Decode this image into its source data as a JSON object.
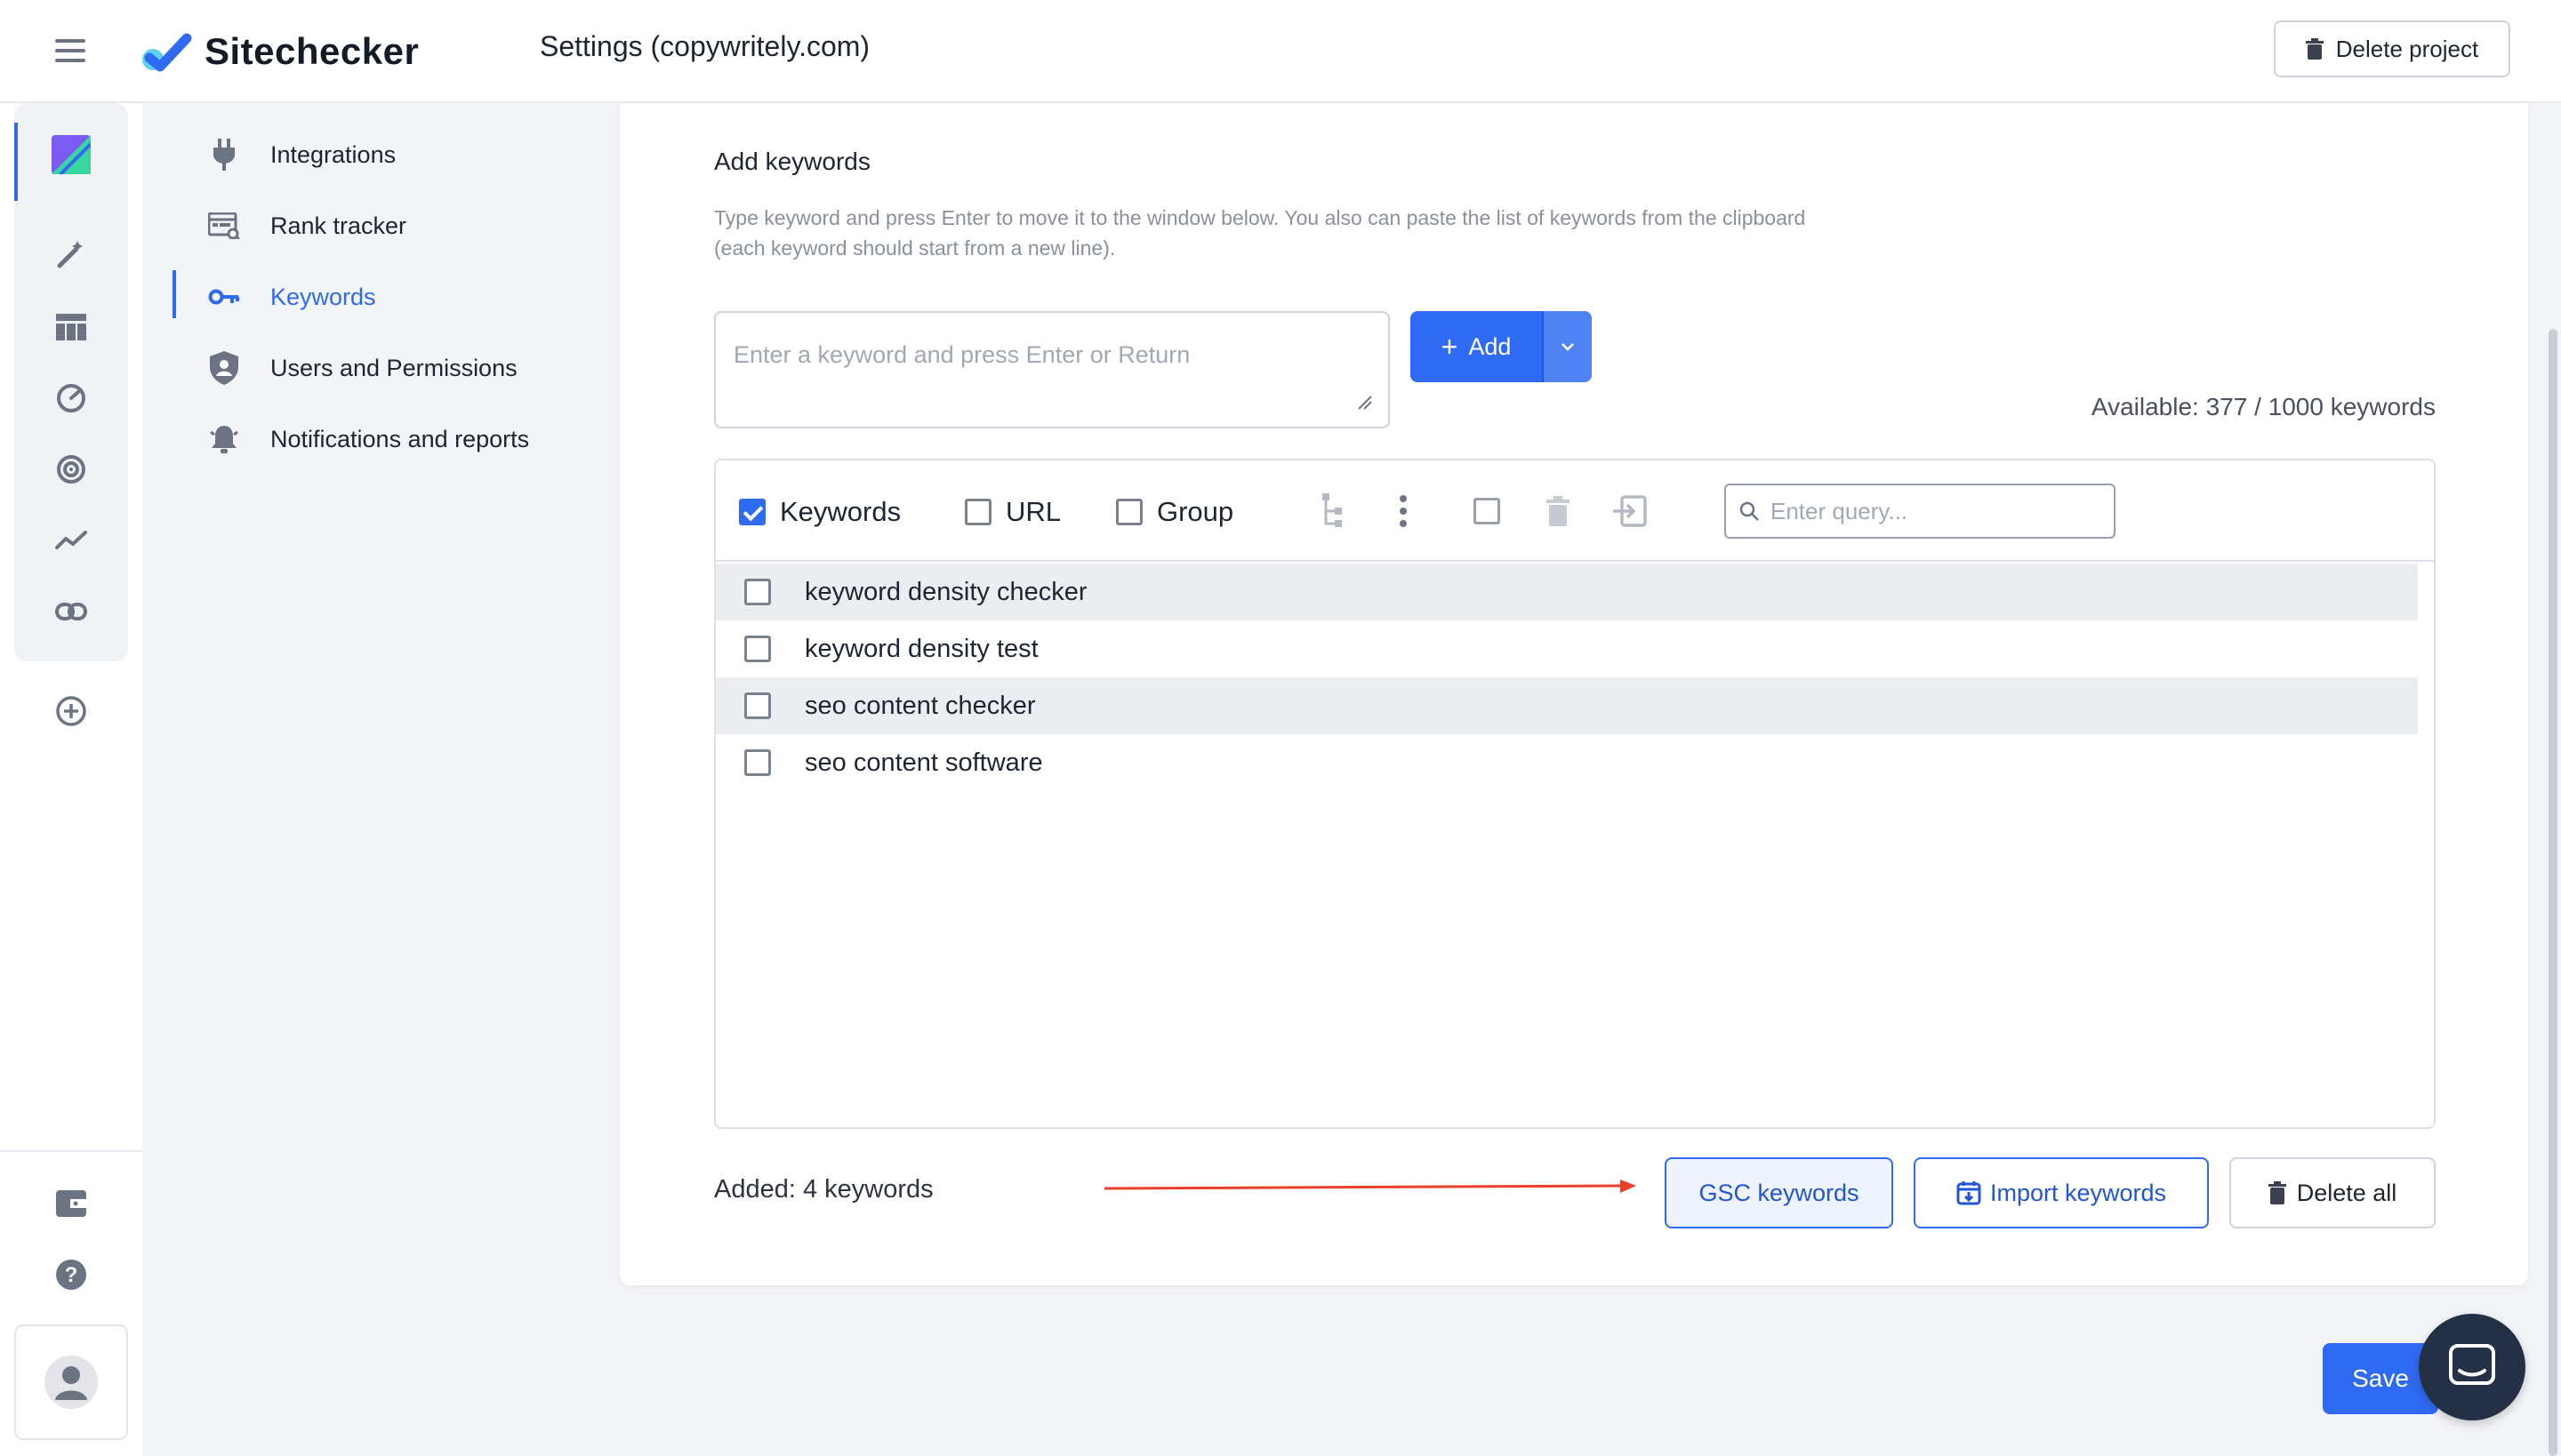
{
  "app": {
    "name": "Sitechecker"
  },
  "header": {
    "title": "Settings (copywritely.com)",
    "delete_project_label": "Delete project"
  },
  "settings_nav": {
    "items": [
      {
        "label": "Integrations",
        "icon": "plug-icon"
      },
      {
        "label": "Rank tracker",
        "icon": "rank-tracker-icon"
      },
      {
        "label": "Keywords",
        "icon": "key-icon",
        "active": true
      },
      {
        "label": "Users and Permissions",
        "icon": "shield-user-icon"
      },
      {
        "label": "Notifications and reports",
        "icon": "bell-icon"
      }
    ]
  },
  "add_keywords": {
    "title": "Add keywords",
    "help_line1": "Type keyword and press Enter to move it to the window below. You also can paste the list of keywords from the clipboard",
    "help_line2": "(each keyword should start from a new line).",
    "input_placeholder": "Enter a keyword and press Enter or Return",
    "add_label": "Add",
    "available": "Available: 377 / 1000 keywords"
  },
  "list": {
    "columns": [
      {
        "label": "Keywords",
        "checked": true
      },
      {
        "label": "URL",
        "checked": false
      },
      {
        "label": "Group",
        "checked": false
      }
    ],
    "search_placeholder": "Enter query...",
    "rows": [
      "keyword density checker",
      "keyword density test",
      "seo content checker",
      "seo content software"
    ]
  },
  "footer": {
    "added": "Added: 4 keywords",
    "gsc_label": "GSC keywords",
    "import_label": "Import keywords",
    "delete_all_label": "Delete all"
  },
  "save_label": "Save",
  "colors": {
    "accent": "#2f6bf2",
    "arrow": "#e8402b",
    "chat": "#243046"
  }
}
